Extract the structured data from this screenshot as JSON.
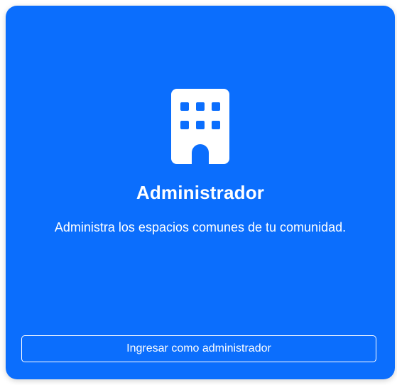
{
  "colors": {
    "card_background": "#0b6efd",
    "text": "#ffffff",
    "button_border": "#ffffff",
    "icon_fill": "#ffffff",
    "icon_cutout": "#0b6efd"
  },
  "card": {
    "icon": "building-icon",
    "title": "Administrador",
    "description": "Administra los espacios comunes de tu comunidad.",
    "button_label": "Ingresar como administrador"
  }
}
